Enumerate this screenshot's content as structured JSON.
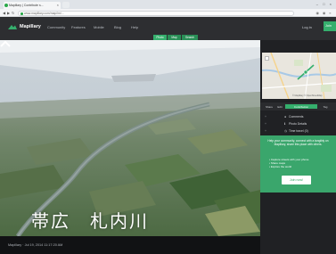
{
  "browser": {
    "tab_title": "Mapillary | Contribute s...",
    "tab_close": "×",
    "window_controls": "– □ ×",
    "url": "www.mapillary.com/map/im/...",
    "icons": [
      "back-icon",
      "forward-icon",
      "reload-icon",
      "lock-icon",
      "star-icon"
    ]
  },
  "header": {
    "brand": "Mapillary",
    "nav": [
      "Community",
      "Features",
      "Mobile",
      "Blog",
      "Help"
    ],
    "login": "Log in",
    "signup": "Join",
    "segments": [
      "Photo",
      "Map",
      "Search"
    ],
    "accent": "#35af6d"
  },
  "viewer": {
    "overlay_title": "帯広　札内川",
    "footer_text": "Mapillary · Jul 19, 2014 11:17:20 AM"
  },
  "panel": {
    "map_credit": "© Mapillary © OpenStreetMap",
    "tabs": [
      "Share",
      "Edit",
      "Contribution",
      "Tag"
    ],
    "rows": [
      {
        "label": "Comments"
      },
      {
        "label": "Photo Details"
      },
      {
        "label": "Time travel (0)"
      }
    ],
    "cta_text": "Help your community, connect with a tangibly on Mapillary, share this place with others.",
    "cta_list": [
      "• Capture streets with your phone",
      "• Share maps",
      "• Explore the world"
    ],
    "join_label": "Join now!"
  },
  "colors": {
    "header_bg": "#2d2e31",
    "panel_bg": "#202124",
    "cta_bg": "#3aa66c"
  }
}
